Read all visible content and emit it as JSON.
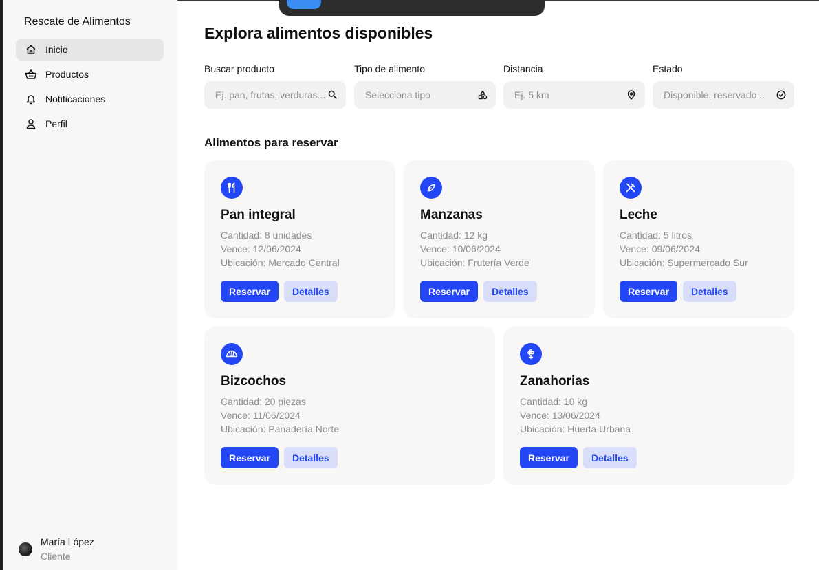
{
  "app": {
    "title": "Rescate de Alimentos"
  },
  "sidebar": {
    "items": [
      {
        "label": "Inicio",
        "icon": "home-icon",
        "active": true
      },
      {
        "label": "Productos",
        "icon": "basket-icon",
        "active": false
      },
      {
        "label": "Notificaciones",
        "icon": "bell-icon",
        "active": false
      },
      {
        "label": "Perfil",
        "icon": "user-icon",
        "active": false
      }
    ]
  },
  "user": {
    "name": "María López",
    "role": "Cliente"
  },
  "main": {
    "title": "Explora alimentos disponibles",
    "section_title": "Alimentos para reservar"
  },
  "filters": [
    {
      "label": "Buscar producto",
      "placeholder": "Ej. pan, frutas, verduras...",
      "icon": "search-icon"
    },
    {
      "label": "Tipo de alimento",
      "placeholder": "Selecciona tipo",
      "icon": "shapes-icon"
    },
    {
      "label": "Distancia",
      "placeholder": "Ej. 5 km",
      "icon": "map-pin-icon"
    },
    {
      "label": "Estado",
      "placeholder": "Disponible, reservado...",
      "icon": "check-circle-icon"
    }
  ],
  "cards": [
    {
      "title": "Pan integral",
      "icon": "utensils-icon",
      "quantity": "Cantidad: 8 unidades",
      "expires": "Vence: 12/06/2024",
      "location": "Ubicación: Mercado Central",
      "reserve_label": "Reservar",
      "details_label": "Detalles"
    },
    {
      "title": "Manzanas",
      "icon": "leaf-icon",
      "quantity": "Cantidad: 12 kg",
      "expires": "Vence: 10/06/2024",
      "location": "Ubicación: Frutería Verde",
      "reserve_label": "Reservar",
      "details_label": "Detalles"
    },
    {
      "title": "Leche",
      "icon": "fork-knife-crossed-icon",
      "quantity": "Cantidad: 5 litros",
      "expires": "Vence: 09/06/2024",
      "location": "Ubicación: Supermercado Sur",
      "reserve_label": "Reservar",
      "details_label": "Detalles"
    },
    {
      "title": "Bizcochos",
      "icon": "croissant-icon",
      "quantity": "Cantidad: 20 piezas",
      "expires": "Vence: 11/06/2024",
      "location": "Ubicación: Panadería Norte",
      "reserve_label": "Reservar",
      "details_label": "Detalles"
    },
    {
      "title": "Zanahorias",
      "icon": "flower-icon",
      "quantity": "Cantidad: 10 kg",
      "expires": "Vence: 13/06/2024",
      "location": "Ubicación: Huerta Urbana",
      "reserve_label": "Reservar",
      "details_label": "Detalles"
    }
  ],
  "colors": {
    "accent": "#2447f5",
    "accent_soft": "#d8def9",
    "card_bg": "#f8f7f6",
    "sidebar_bg": "#f7f7f7"
  }
}
